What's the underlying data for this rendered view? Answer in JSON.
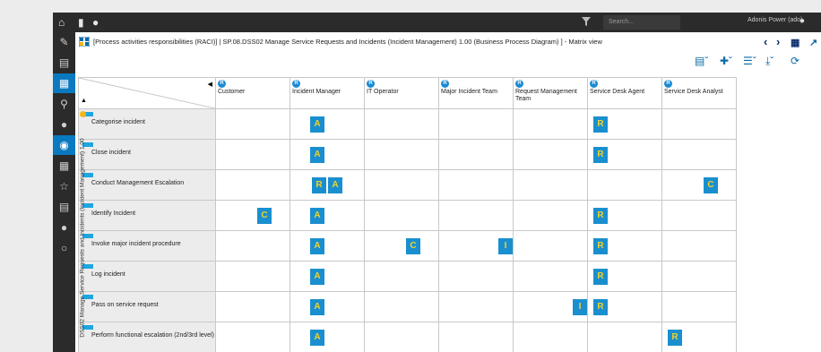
{
  "search": {
    "placeholder": "Search..."
  },
  "user": {
    "name": "Adonis Power (ado)"
  },
  "title": "[Process activities responsibilities (RACI)] | SP.08.DSS02 Manage Service Requests and Incidents (Incident Management) 1.00 (Business Process Diagram) ] - Matrix view",
  "matrix": {
    "vertical_label": "DSS02 Manage Service Requests and Incidents (Incident Management) 1.00",
    "role_marker": "R",
    "columns": [
      "Customer",
      "Incident Manager",
      "IT Operator",
      "Major Incident Team",
      "Request Management Team",
      "Service Desk Agent",
      "Service Desk Analyst"
    ],
    "rows": [
      {
        "label": "Categorise incident",
        "cells": [
          "",
          "A",
          "",
          "",
          "",
          "R",
          ""
        ]
      },
      {
        "label": "Close incident",
        "cells": [
          "",
          "A",
          "",
          "",
          "",
          "R",
          ""
        ]
      },
      {
        "label": "Conduct Management Escalation",
        "cells": [
          "",
          "R A",
          "",
          "",
          "",
          "",
          "C"
        ]
      },
      {
        "label": "Identify Incident",
        "cells": [
          "C",
          "A",
          "",
          "",
          "",
          "R",
          ""
        ]
      },
      {
        "label": "Invoke major incident procedure",
        "cells": [
          "",
          "A",
          "C",
          "I",
          "",
          "R",
          ""
        ]
      },
      {
        "label": "Log incident",
        "cells": [
          "",
          "A",
          "",
          "",
          "",
          "R",
          ""
        ]
      },
      {
        "label": "Pass on service request",
        "cells": [
          "",
          "A",
          "",
          "",
          "I",
          "R",
          ""
        ]
      },
      {
        "label": "Perform functional escalation (2nd/3rd level)",
        "cells": [
          "",
          "A",
          "",
          "",
          "",
          "",
          "R"
        ]
      }
    ]
  }
}
